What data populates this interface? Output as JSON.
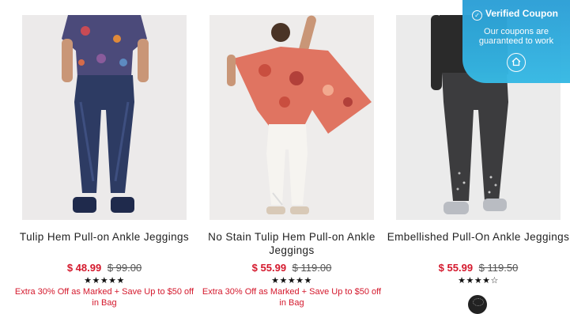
{
  "products": [
    {
      "name": "Tulip Hem Pull-on Ankle Jeggings",
      "sale_price": "$ 48.99",
      "original_price": "$ 99.00",
      "rating_stars": "★★★★★",
      "rating": 5,
      "promo": "Extra 30% Off as Marked + Save Up to $50 off in Bag"
    },
    {
      "name": "No Stain Tulip Hem Pull-on Ankle Jeggings",
      "sale_price": "$ 55.99",
      "original_price": "$ 119.00",
      "rating_stars": "★★★★★",
      "rating": 5,
      "promo": "Extra 30% Off as Marked + Save Up to $50 off in Bag"
    },
    {
      "name": "Embellished Pull-On Ankle Jeggings",
      "sale_price": "$ 55.99",
      "original_price": "$ 119.50",
      "rating_stars": "★★★★☆",
      "rating": 4.5,
      "promo": ""
    }
  ],
  "coupon": {
    "title": "Verified Coupon",
    "subtitle": "Our coupons are guaranteed to work",
    "icon": "home-icon",
    "color": "#2fa8dc"
  },
  "colors": {
    "sale": "#d4182c",
    "background": "#ffffff",
    "photo_bg": "#eeeeee"
  }
}
